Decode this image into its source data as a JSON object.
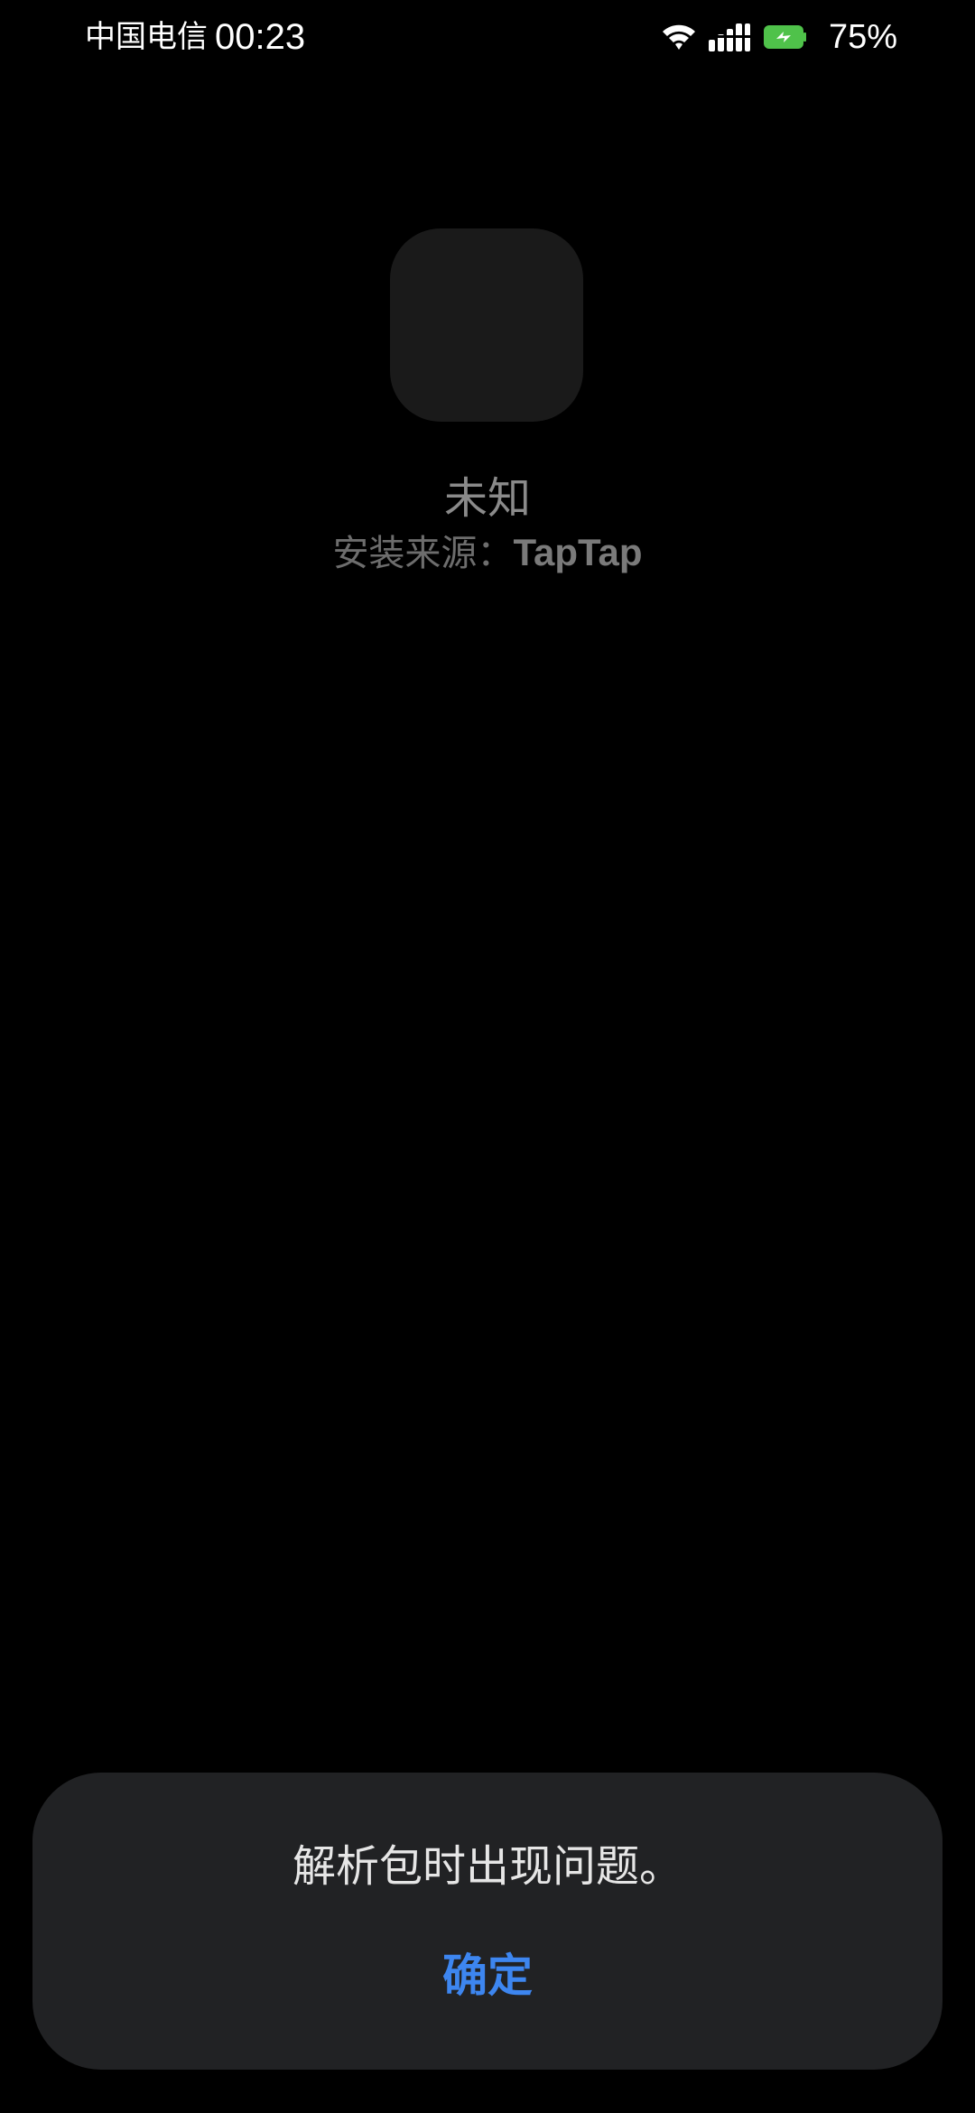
{
  "status_bar": {
    "carrier": "中国电信",
    "time": "00:23",
    "battery_percent": "75%",
    "icons": [
      "wifi-icon",
      "signal-icon",
      "battery-charging-icon"
    ],
    "battery_color": "#4fc24a"
  },
  "app": {
    "name": "未知",
    "install_source_label": "安装来源：",
    "install_source_value": "TapTap"
  },
  "dialog": {
    "message": "解析包时出现问题。",
    "confirm_label": "确定",
    "confirm_color": "#3d86f0"
  }
}
